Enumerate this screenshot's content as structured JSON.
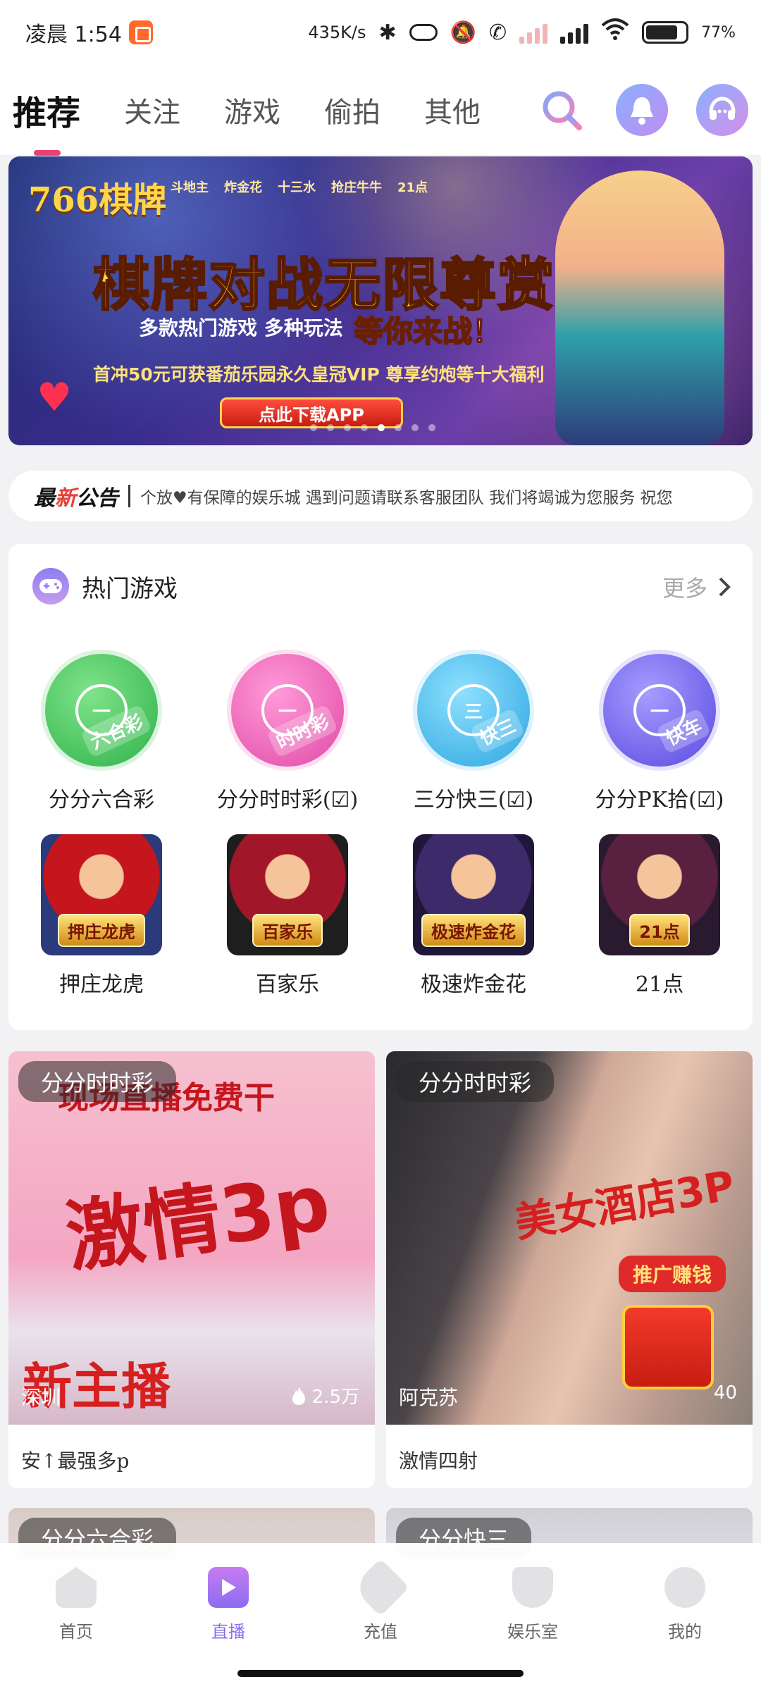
{
  "status_bar": {
    "time": "凌晨 1:54",
    "speed": "435K/s",
    "battery": "77%"
  },
  "header": {
    "tabs": [
      {
        "label": "推荐",
        "active": true
      },
      {
        "label": "关注",
        "active": false
      },
      {
        "label": "游戏",
        "active": false
      },
      {
        "label": "偷拍",
        "active": false
      },
      {
        "label": "其他",
        "active": false
      }
    ],
    "icons": [
      "search-icon",
      "bell-icon",
      "support-icon"
    ]
  },
  "banner": {
    "logo": "766棋牌",
    "tags": [
      "斗地主",
      "炸金花",
      "十三水",
      "抢庄牛牛",
      "21点"
    ],
    "title": "棋牌对战无限尊赏",
    "subtitle": "多款热门游戏 多种玩法",
    "slogan": "等你来战！",
    "promo": "首冲50元可获番茄乐园永久皇冠VIP 尊享约炮等十大福利",
    "button": "点此下载APP",
    "slide_count": 8,
    "active_slide": 4
  },
  "notice": {
    "label_prefix": "最",
    "label_accent": "新",
    "label_suffix": "公告",
    "text": "个放♥有保障的娱乐城 遇到问题请联系客服团队 我们将竭诚为您服务 祝您"
  },
  "hot_games": {
    "title": "热门游戏",
    "more": "更多",
    "games": [
      {
        "name": "分分六合彩",
        "badge": "一",
        "tag": "六合彩",
        "color": "#3dc95a"
      },
      {
        "name": "分分时时彩(☑)",
        "badge": "一",
        "tag": "时时彩",
        "color": "#ec5fb8"
      },
      {
        "name": "三分快三(☑)",
        "badge": "三",
        "tag": "快三",
        "color": "#3ab3e6"
      },
      {
        "name": "分分PK拾(☑)",
        "badge": "一",
        "tag": "快车",
        "color": "#6b5ce8"
      },
      {
        "name": "押庄龙虎",
        "tag": "押庄龙虎"
      },
      {
        "name": "百家乐",
        "tag": "百家乐"
      },
      {
        "name": "极速炸金花",
        "tag": "极速炸金花"
      },
      {
        "name": "21点",
        "tag": "21点"
      }
    ]
  },
  "feed": [
    {
      "pill": "分分时时彩",
      "overlay_top": "现场直播免费干",
      "overlay_mid": "激情3p",
      "overlay_bottom": "新主播",
      "city": "深圳",
      "views": "2.5万",
      "caption": "安↑最强多p"
    },
    {
      "pill": "分分时时彩",
      "overlay_mid": "美女酒店3P",
      "overlay_badge": "推广赚钱",
      "city": "阿克苏",
      "views": "40",
      "caption": "激情四射"
    }
  ],
  "feed_peek": [
    {
      "pill": "分分六合彩"
    },
    {
      "pill": "分分快三"
    }
  ],
  "bottom_nav": [
    {
      "label": "首页",
      "active": false
    },
    {
      "label": "直播",
      "active": true
    },
    {
      "label": "充值",
      "active": false
    },
    {
      "label": "娱乐室",
      "active": false
    },
    {
      "label": "我的",
      "active": false
    }
  ]
}
